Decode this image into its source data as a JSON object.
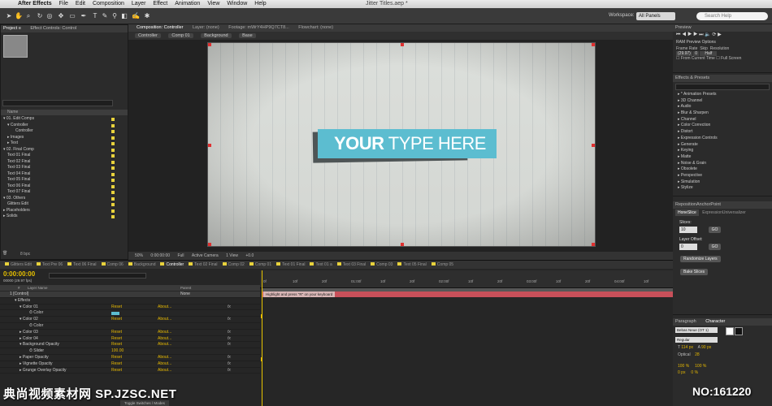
{
  "menubar": {
    "app": "After Effects",
    "items": [
      "File",
      "Edit",
      "Composition",
      "Layer",
      "Effect",
      "Animation",
      "View",
      "Window",
      "Help"
    ],
    "document": "Jitter Titles.aep *"
  },
  "toolbar": {
    "workspace_label": "Workspace:",
    "workspace_value": "All Panels",
    "help_placeholder": "Search Help"
  },
  "project": {
    "tabs": [
      "Project ≡",
      "Effect Controls: Control"
    ],
    "footer": "8 bpc",
    "columns": "Name",
    "items": [
      {
        "label": "▾ 01. Edit Comps",
        "indent": 0
      },
      {
        "label": "▾ Controller",
        "indent": 1
      },
      {
        "label": "Controller",
        "indent": 3
      },
      {
        "label": "▸ Images",
        "indent": 1
      },
      {
        "label": "▸ Text",
        "indent": 1
      },
      {
        "label": "▾ 02. Final Comp",
        "indent": 0
      },
      {
        "label": "Text 01 Final",
        "indent": 1
      },
      {
        "label": "Text 02 Final",
        "indent": 1
      },
      {
        "label": "Text 03 Final",
        "indent": 1
      },
      {
        "label": "Text 04 Final",
        "indent": 1
      },
      {
        "label": "Text 05 Final",
        "indent": 1
      },
      {
        "label": "Text 06 Final",
        "indent": 1
      },
      {
        "label": "Text 07 Final",
        "indent": 1
      },
      {
        "label": "▾ 03. Others",
        "indent": 0
      },
      {
        "label": "Glitters Edit",
        "indent": 1
      },
      {
        "label": "▸ Placeholders",
        "indent": 0
      },
      {
        "label": "▸ Solids",
        "indent": 0
      }
    ]
  },
  "composition": {
    "tabs": [
      "Composition: Controller",
      "Layer: (none)",
      "Footage: mWrY4HP9Q7CT8...",
      "Flowchart: (none)"
    ],
    "breadcrumbs": [
      "Controller",
      "Comp 01",
      "Background",
      "Base"
    ],
    "lower_third_bold": "YOUR",
    "lower_third_light": " TYPE HERE",
    "footer": [
      "50%",
      "0:00:00:00",
      "Full",
      "Active Camera",
      "1 View",
      "+0.0"
    ]
  },
  "preview": {
    "title": "Preview",
    "ram_options": "RAM Preview Options",
    "frame_rate_label": "Frame Rate",
    "skip_label": "Skip",
    "resolution_label": "Resolution",
    "frame_rate": "(29.97)",
    "skip": "0",
    "resolution": "Half",
    "from_current": "From Current Time",
    "full_screen": "Full Screen"
  },
  "effects_presets": {
    "title": "Effects & Presets",
    "items": [
      "* Animation Presets",
      "3D Channel",
      "Audio",
      "Blur & Sharpen",
      "Channel",
      "Color Correction",
      "Distort",
      "Expression Controls",
      "Generate",
      "Keying",
      "Matte",
      "Noise & Grain",
      "Obsolete",
      "Perspective",
      "Simulation",
      "Stylize"
    ]
  },
  "script_panel": {
    "title": "RepositionAnchorPoint",
    "tabs": [
      "HoneSlice",
      "ExpressionUniversalizer"
    ],
    "slices_label": "Slices:",
    "slices_value": "10",
    "go": "GO",
    "layer_offset_label": "Layer Offset:",
    "layer_offset_value": "0",
    "randomize": "Randomize Layers",
    "bake": "Bake Slices"
  },
  "character": {
    "tabs": [
      "Paragraph",
      "Character"
    ],
    "font": "Bebas Neue (OT 1)",
    "style": "Regular",
    "size": "114 px",
    "leading": "90 px",
    "kerning": "Optical",
    "tracking": "28",
    "scale_v": "100 %",
    "scale_h": "100 %",
    "baseline": "0 px",
    "tsume": "0 %"
  },
  "timeline": {
    "timecode": "0:00:00:00",
    "fps": "00000 (29.97 fps)",
    "tabs": [
      "Glitters Edit",
      "Text Pre 06",
      "Text 06 Final",
      "Comp 06",
      "Background",
      "Controller",
      "Text 02 Final",
      "Comp 02",
      "Comp 01",
      "Text 01 Final",
      "Text 01 a",
      "Text 03 Final",
      "Comp 03",
      "Text 05 Final",
      "Comp 05"
    ],
    "active_tab": "Controller",
    "columns": [
      "#",
      "Layer Name",
      "Parent"
    ],
    "ruler_ticks": [
      "0f",
      "10f",
      "20f",
      "01:00f",
      "10f",
      "20f",
      "02:00f",
      "10f",
      "20f",
      "03:00f",
      "10f",
      "20f",
      "04:00f",
      "10f"
    ],
    "layer_marker": "Highlight and press \"R\" on your keyboard",
    "toggle_label": "Toggle Switches / Modes",
    "rows": [
      {
        "name": "1    [Control]",
        "indent": 0,
        "reset": "",
        "about": "",
        "fx": "",
        "value": "None"
      },
      {
        "name": "▾ Effects",
        "indent": 1,
        "reset": "",
        "about": "",
        "fx": "",
        "value": ""
      },
      {
        "name": "▾ Color 01",
        "indent": 2,
        "reset": "Reset",
        "about": "About...",
        "fx": "fx",
        "value": ""
      },
      {
        "name": "⏱ Color",
        "indent": 4,
        "reset": "",
        "about": "",
        "fx": "",
        "value": "swatch"
      },
      {
        "name": "▾ Color 02",
        "indent": 2,
        "reset": "Reset",
        "about": "About...",
        "fx": "fx",
        "value": ""
      },
      {
        "name": "⏱ Color",
        "indent": 4,
        "reset": "",
        "about": "",
        "fx": "",
        "value": ""
      },
      {
        "name": "▸ Color 03",
        "indent": 2,
        "reset": "Reset",
        "about": "About...",
        "fx": "fx",
        "value": ""
      },
      {
        "name": "▸ Color 04",
        "indent": 2,
        "reset": "Reset",
        "about": "About...",
        "fx": "fx",
        "value": ""
      },
      {
        "name": "▾ Background Opacity",
        "indent": 2,
        "reset": "Reset",
        "about": "About...",
        "fx": "fx",
        "value": ""
      },
      {
        "name": "⏱ Slider",
        "indent": 4,
        "reset": "",
        "about": "",
        "fx": "",
        "value": "100.00"
      },
      {
        "name": "▸ Paper Opacity",
        "indent": 2,
        "reset": "Reset",
        "about": "About...",
        "fx": "fx",
        "value": ""
      },
      {
        "name": "▸ Vignette Opacity",
        "indent": 2,
        "reset": "Reset",
        "about": "About...",
        "fx": "fx",
        "value": ""
      },
      {
        "name": "▸ Grunge Overlay Opacity",
        "indent": 2,
        "reset": "Reset",
        "about": "About...",
        "fx": "fx",
        "value": ""
      }
    ]
  },
  "watermark": {
    "left": "典尚视频素材网 SP.JZSC.NET",
    "right": "NO:161220"
  },
  "colors": {
    "accent_blue": "#5cbdd0",
    "timecode_yellow": "#e6c000",
    "layer_bar": "#c8505a"
  }
}
